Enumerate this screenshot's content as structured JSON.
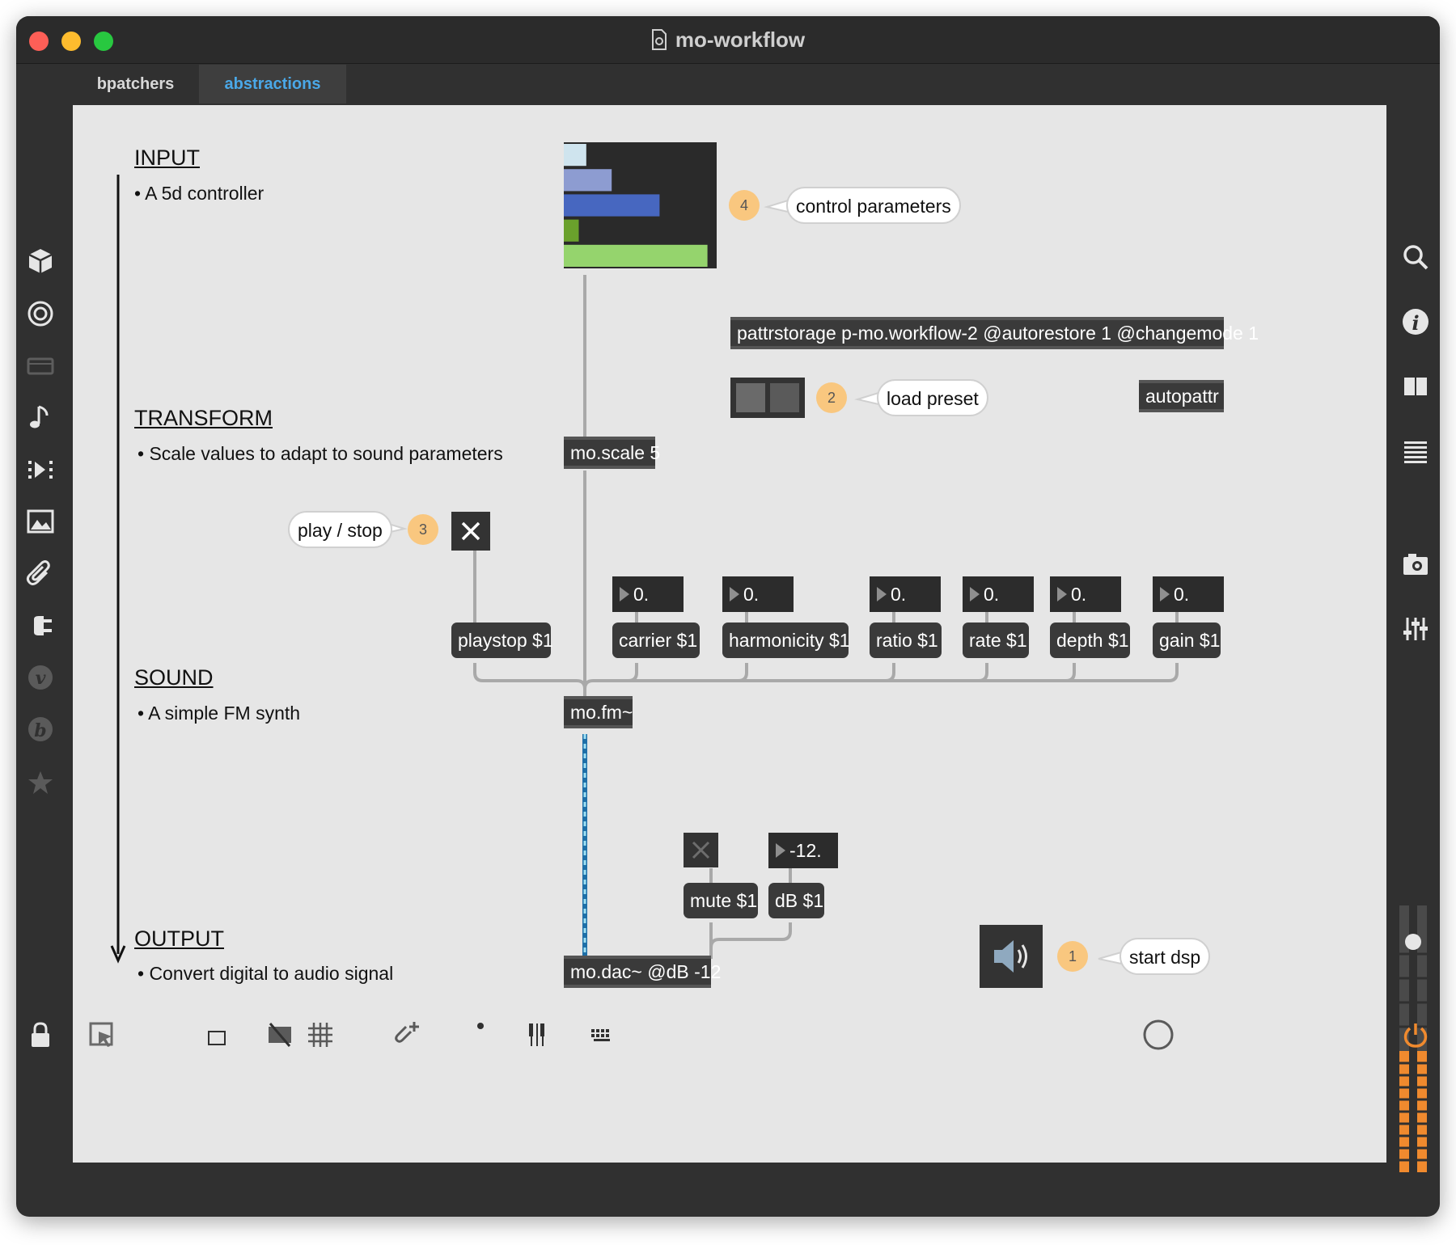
{
  "window": {
    "title": "mo-workflow"
  },
  "tabs": [
    {
      "label": "bpatchers",
      "active": false
    },
    {
      "label": "abstractions",
      "active": true
    }
  ],
  "colors": {
    "accent": "#4aa8e8",
    "badge": "#f9c77f",
    "canvas": "#e6e6e6",
    "object": "#3a3a3a"
  },
  "sections": {
    "input": {
      "heading": "INPUT",
      "note": "• A 5d controller"
    },
    "transform": {
      "heading": "TRANSFORM",
      "note": "• Scale values to adapt to sound parameters"
    },
    "sound": {
      "heading": "SOUND",
      "note": "• A simple FM synth"
    },
    "output": {
      "heading": "OUTPUT",
      "note": "• Convert digital to audio signal"
    }
  },
  "multislider": {
    "values": [
      0.15,
      0.32,
      0.64,
      0.1,
      0.96
    ],
    "colors": [
      "#cfe4ee",
      "#8d9cd1",
      "#4767c0",
      "#6aa12c",
      "#95d46d"
    ]
  },
  "objects": {
    "pattrstorage": "pattrstorage p-mo.workflow-2 @autorestore 1 @changemode 1",
    "autopattr": "autopattr",
    "scale": "mo.scale 5",
    "fm": "mo.fm~",
    "dac": "mo.dac~ @dB -12"
  },
  "messages": {
    "playstop": "playstop $1",
    "carrier": "carrier $1",
    "harmonicity": "harmonicity $1",
    "ratio": "ratio $1",
    "rate": "rate $1",
    "depth": "depth $1",
    "gain": "gain $1",
    "mute": "mute $1",
    "db": "dB $1"
  },
  "numbers": {
    "carrier": "0.",
    "harmonicity": "0.",
    "ratio": "0.",
    "rate": "0.",
    "depth": "0.",
    "gain": "0.",
    "db": "-12."
  },
  "annotations": [
    {
      "badge": "1",
      "label": "start dsp"
    },
    {
      "badge": "2",
      "label": "load preset"
    },
    {
      "badge": "3",
      "label": "play / stop"
    },
    {
      "badge": "4",
      "label": "control parameters"
    }
  ],
  "right_toolbar": [
    "search-icon",
    "info-icon",
    "split-view-icon",
    "list-icon",
    "camera-icon",
    "mixer-icon"
  ],
  "left_toolbar": [
    "cube-icon",
    "target-icon",
    "film-icon",
    "music-note-icon",
    "media-step-icon",
    "image-icon",
    "paperclip-icon",
    "plug-icon",
    "v-icon",
    "b-icon",
    "star-icon"
  ],
  "bottom_toolbar": [
    "lock-icon",
    "select-icon",
    "presentation-icon",
    "windows-icon",
    "grid-off-icon",
    "grid-icon",
    "add-icon",
    "wrench-icon",
    "piano-icon",
    "keyboard-icon",
    "play-icon",
    "power-icon"
  ]
}
